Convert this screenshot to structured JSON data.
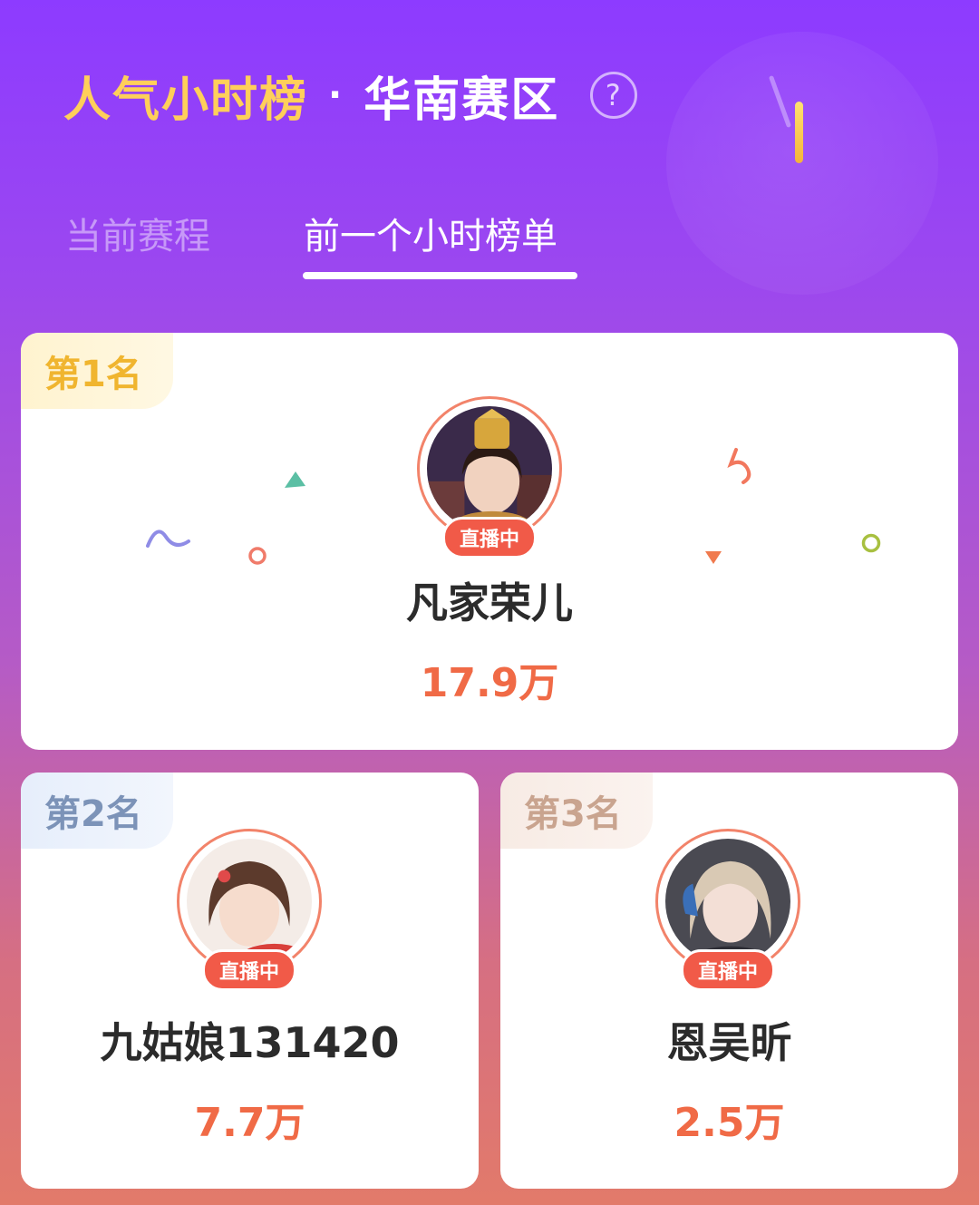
{
  "header": {
    "title_part1": "人气小时榜",
    "separator": "·",
    "title_part2": "华南赛区",
    "help_icon_glyph": "?"
  },
  "tabs": [
    {
      "label": "当前赛程",
      "active": false
    },
    {
      "label": "前一个小时榜单",
      "active": true
    }
  ],
  "ranking": [
    {
      "rank_label": "第1名",
      "name": "凡家荣儿",
      "score": "17.9万",
      "live_badge": "直播中"
    },
    {
      "rank_label": "第2名",
      "name": "九姑娘131420",
      "score": "7.7万",
      "live_badge": "直播中"
    },
    {
      "rank_label": "第3名",
      "name": "恩吴昕",
      "score": "2.5万",
      "live_badge": "直播中"
    }
  ],
  "colors": {
    "accent_gold": "#ffcf5a",
    "score_orange": "#f06a46",
    "live_red": "#f15a48"
  }
}
